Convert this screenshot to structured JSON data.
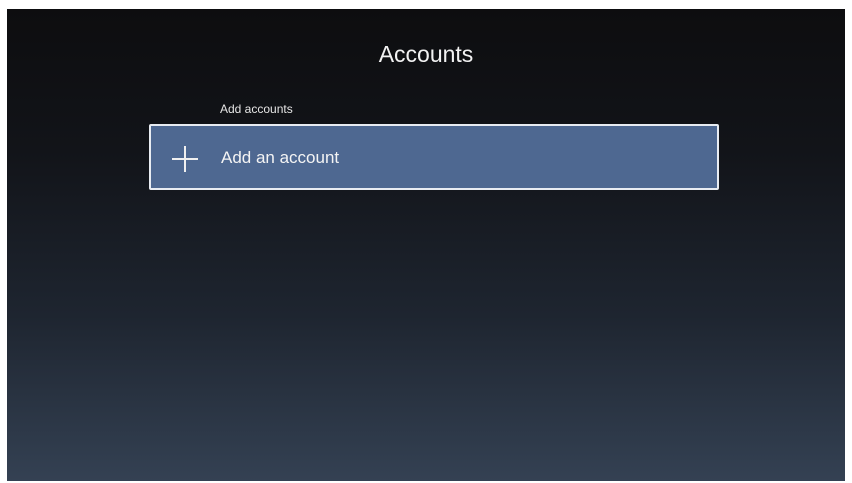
{
  "header": {
    "title": "Accounts"
  },
  "section": {
    "label": "Add accounts",
    "items": [
      {
        "label": "Add an account",
        "icon": "plus-icon"
      }
    ]
  },
  "colors": {
    "item_focus_background": "#4e6891",
    "item_focus_border": "#e8ecf2",
    "background_top": "#0d0d0f",
    "background_bottom": "#344153"
  }
}
